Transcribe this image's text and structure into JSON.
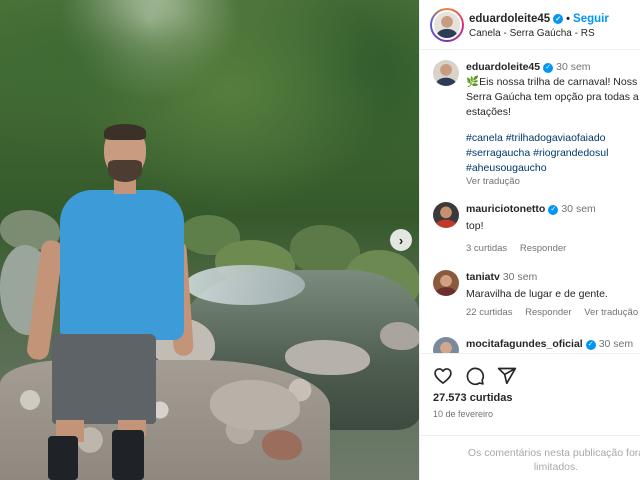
{
  "post": {
    "author": {
      "username": "eduardoleite45",
      "verified": true,
      "follow_label": "Seguir",
      "separator": "•",
      "location": "Canela - Serra Gaúcha - RS"
    },
    "caption": {
      "username": "eduardoleite45",
      "time": "30 sem",
      "lines": [
        "🌿Eis nossa trilha de carnaval! Noss",
        "Serra Gaúcha tem opção pra todas a",
        "estações!"
      ],
      "hashtag_lines": [
        "#canela #trilhadogaviaofaiado",
        "#serragaucha #riograndedosul",
        "#aheusougaucho"
      ],
      "see_translation": "Ver tradução"
    },
    "comments": [
      {
        "username": "mauriciotonetto",
        "verified": true,
        "time": "30 sem",
        "text": "top!",
        "likes": "3 curtidas",
        "reply": "Responder",
        "translation": ""
      },
      {
        "username": "taniatv",
        "verified": false,
        "time": "30 sem",
        "text": "Maravilha de lugar e de gente.",
        "likes": "22 curtidas",
        "reply": "Responder",
        "translation": "Ver tradução"
      },
      {
        "username": "mocitafagundes_oficial",
        "verified": true,
        "time": "30 sem",
        "text": "",
        "likes": "",
        "reply": "",
        "translation": ""
      }
    ],
    "stats": {
      "likes": "27.573 curtidas",
      "date": "10 de fevereiro"
    },
    "comments_closed": [
      "Os comentários nesta publicação fora",
      "limitados."
    ],
    "icons": {
      "like": "heart-icon",
      "comment": "comment-icon",
      "share": "share-icon",
      "next": "chevron-right-icon",
      "verified": "verified-badge-icon"
    },
    "colors": {
      "accent": "#0095f6",
      "hashtag": "#00376b",
      "muted": "#737373"
    }
  }
}
